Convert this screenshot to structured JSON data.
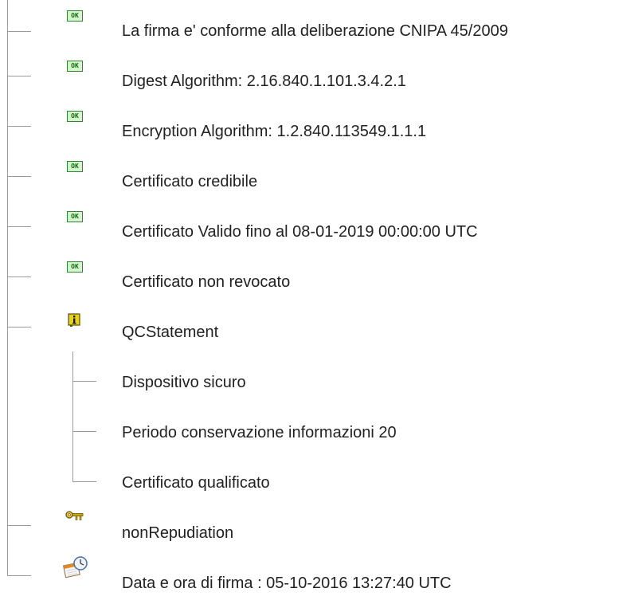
{
  "items": [
    {
      "label": "La firma e' conforme alla deliberazione CNIPA 45/2009",
      "icon": "ok-icon",
      "badge": "OK"
    },
    {
      "label": "Digest Algorithm: 2.16.840.1.101.3.4.2.1",
      "icon": "ok-icon",
      "badge": "OK"
    },
    {
      "label": "Encryption Algorithm: 1.2.840.113549.1.1.1",
      "icon": "ok-icon",
      "badge": "OK"
    },
    {
      "label": "Certificato credibile",
      "icon": "ok-icon",
      "badge": "OK"
    },
    {
      "label": "Certificato Valido fino al 08-01-2019 00:00:00 UTC",
      "icon": "ok-icon",
      "badge": "OK"
    },
    {
      "label": "Certificato non revocato",
      "icon": "ok-icon",
      "badge": "OK"
    },
    {
      "label": "QCStatement",
      "icon": "info-icon",
      "children": [
        {
          "label": "Dispositivo sicuro"
        },
        {
          "label": "Periodo conservazione informazioni 20"
        },
        {
          "label": "Certificato qualificato"
        }
      ]
    },
    {
      "label": "nonRepudiation",
      "icon": "key-icon"
    },
    {
      "label": "Data e ora di firma : 05-10-2016 13:27:40 UTC",
      "icon": "clock-icon"
    }
  ],
  "colors": {
    "tree_line": "#9a9a9a",
    "ok_badge_fill": "#d8f3d0",
    "ok_badge_border": "#2a8a2a",
    "info_icon": "#e6d21a",
    "key_icon": "#c9a615",
    "text": "#222222"
  }
}
